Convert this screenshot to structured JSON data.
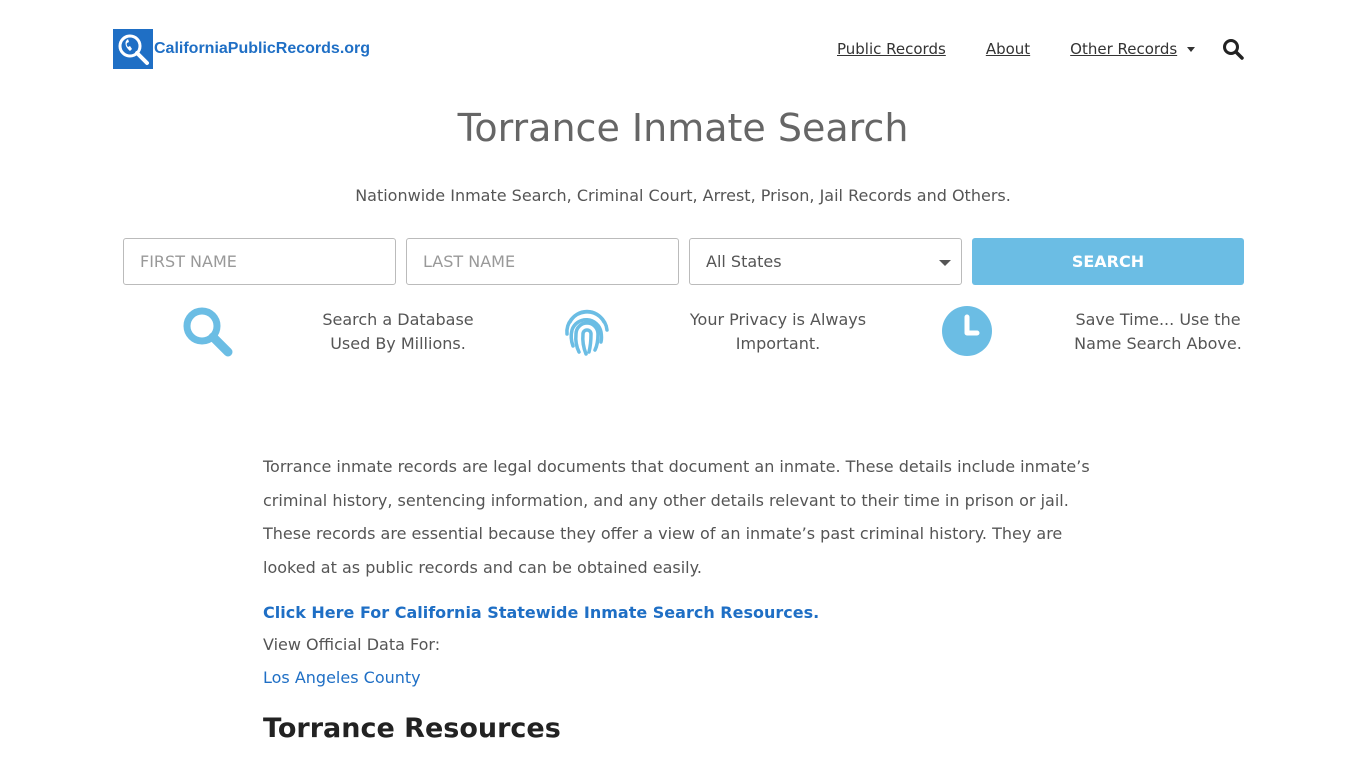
{
  "header": {
    "logo_text": "CaliforniaPublicRecords.org",
    "nav": [
      {
        "label": "Public Records"
      },
      {
        "label": "About"
      },
      {
        "label": "Other Records"
      }
    ]
  },
  "page": {
    "title": "Torrance Inmate Search",
    "subtitle": "Nationwide Inmate Search, Criminal Court, Arrest, Prison, Jail Records and Others."
  },
  "search_form": {
    "first_name_placeholder": "FIRST NAME",
    "last_name_placeholder": "LAST NAME",
    "state_selected": "All States",
    "search_label": "SEARCH"
  },
  "features": [
    {
      "icon": "magnifier-icon",
      "line1": "Search a Database",
      "line2": "Used By Millions."
    },
    {
      "icon": "fingerprint-icon",
      "line1": "Your Privacy is Always",
      "line2": "Important."
    },
    {
      "icon": "clock-icon",
      "line1": "Save Time... Use the",
      "line2": "Name Search Above."
    }
  ],
  "content": {
    "paragraph1": "Torrance inmate records are legal documents that document an inmate. These details include inmate’s criminal history, sentencing information, and any other details relevant to their time in prison or jail.",
    "paragraph2": "These records are essential because they offer a view of an inmate’s past criminal history. They are looked at as public records and can be obtained easily.",
    "statewide_link": "Click Here For California Statewide Inmate Search Resources.",
    "view_official": "View Official Data For:",
    "county_link": "Los Angeles County",
    "resources_heading": "Torrance Resources"
  },
  "colors": {
    "brand_blue": "#1f6fc5",
    "accent_light_blue": "#6bbde4"
  }
}
